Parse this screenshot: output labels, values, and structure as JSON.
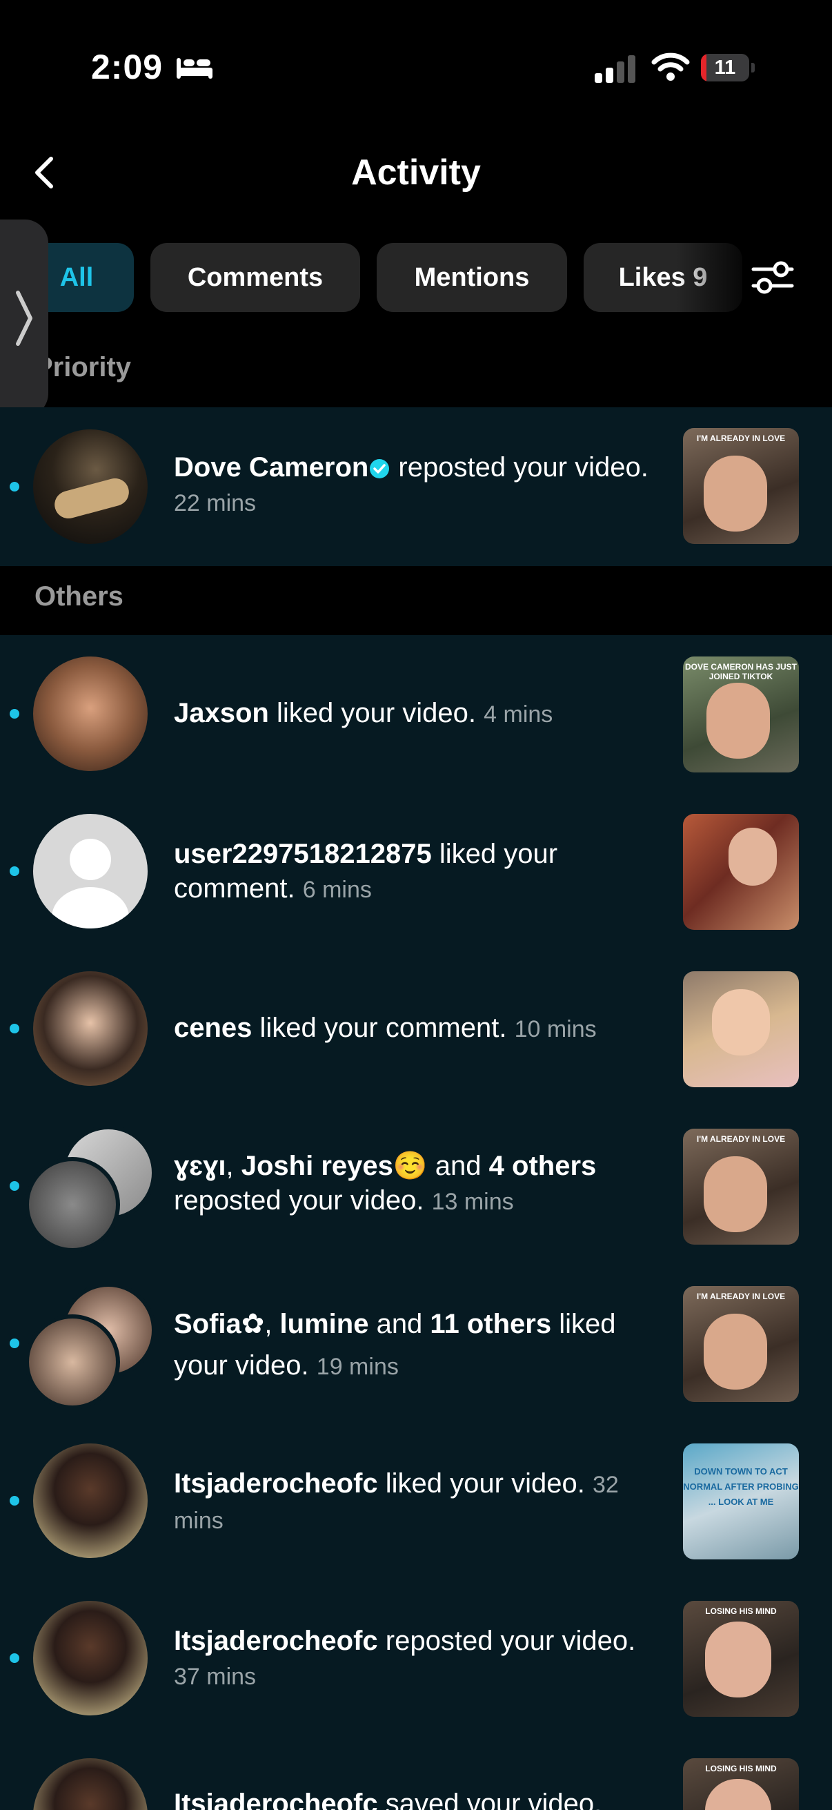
{
  "status_bar": {
    "time": "2:09",
    "battery": "11",
    "battery_level": 0.11
  },
  "header": {
    "title": "Activity"
  },
  "tabs": [
    {
      "label": "All",
      "active": true
    },
    {
      "label": "Comments",
      "active": false
    },
    {
      "label": "Mentions",
      "active": false
    },
    {
      "label": "Likes 9",
      "active": false
    }
  ],
  "sections": {
    "priority": "Priority",
    "others": "Others"
  },
  "notifications": [
    {
      "segments": [
        {
          "text": "Dove Cameron",
          "bold": true
        },
        {
          "text": " reposted your video.",
          "bold": false
        }
      ],
      "time": "22 mins",
      "verified": true
    },
    {
      "segments": [
        {
          "text": "Jaxson",
          "bold": true
        },
        {
          "text": " liked your video.",
          "bold": false
        }
      ],
      "time": "4 mins"
    },
    {
      "segments": [
        {
          "text": "user2297518212875",
          "bold": true
        },
        {
          "text": " liked your comment.",
          "bold": false
        }
      ],
      "time": "6 mins"
    },
    {
      "segments": [
        {
          "text": "cenes",
          "bold": true
        },
        {
          "text": " liked your comment.",
          "bold": false
        }
      ],
      "time": "10 mins"
    },
    {
      "segments": [
        {
          "text": "ɣɛɣı",
          "bold": true
        },
        {
          "text": ", ",
          "bold": false
        },
        {
          "text": "Joshi reyes☺️",
          "bold": true
        },
        {
          "text": " and ",
          "bold": false
        },
        {
          "text": "4 others",
          "bold": true
        },
        {
          "text": " reposted your video.",
          "bold": false
        }
      ],
      "time": "13 mins"
    },
    {
      "segments": [
        {
          "text": "Sofia✿",
          "bold": true
        },
        {
          "text": ", ",
          "bold": false
        },
        {
          "text": "lumine",
          "bold": true
        },
        {
          "text": " and ",
          "bold": false
        },
        {
          "text": "11 others",
          "bold": true
        },
        {
          "text": " liked your video.",
          "bold": false
        }
      ],
      "time": "19 mins"
    },
    {
      "segments": [
        {
          "text": "Itsjaderocheofc",
          "bold": true
        },
        {
          "text": " liked your video.",
          "bold": false
        }
      ],
      "time": "32 mins"
    },
    {
      "segments": [
        {
          "text": "Itsjaderocheofc",
          "bold": true
        },
        {
          "text": " reposted your video.",
          "bold": false
        }
      ],
      "time": "37 mins"
    },
    {
      "segments": [
        {
          "text": "Itsjaderocheofc",
          "bold": true
        },
        {
          "text": " saved your video.",
          "bold": false
        }
      ],
      "time": ""
    }
  ],
  "thumbnail_captions": [
    "I'M ALREADY IN LOVE",
    "DOVE CAMERON HAS JUST JOINED TIKTOK",
    "",
    "",
    "I'M ALREADY IN LOVE",
    "I'M ALREADY IN LOVE",
    "DOWN TOWN TO ACT NORMAL AFTER PROBING ... LOOK AT ME",
    "LOSING HIS MIND",
    "LOSING HIS MIND"
  ],
  "colors": {
    "accent": "#1ec4e8",
    "row_bg": "#061a22",
    "background": "#000000"
  }
}
